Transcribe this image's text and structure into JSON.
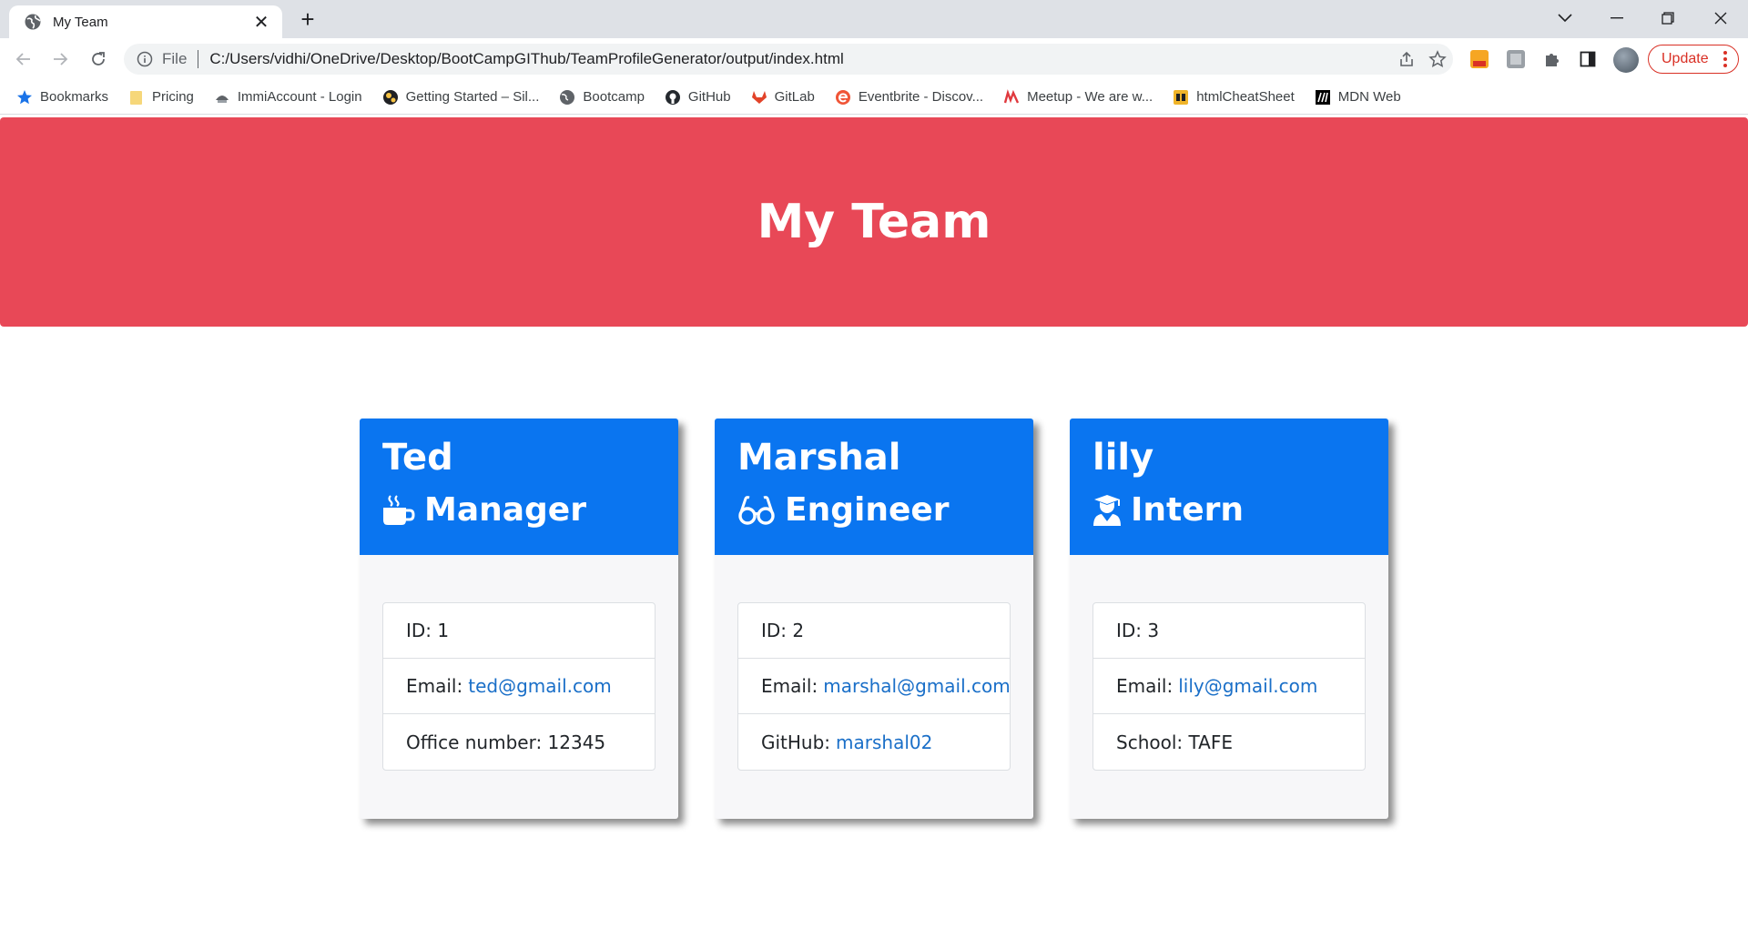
{
  "browser": {
    "tab_title": "My Team",
    "omnibox": {
      "scheme": "File",
      "url": "C:/Users/vidhi/OneDrive/Desktop/BootCampGIThub/TeamProfileGenerator/output/index.html"
    },
    "update_label": "Update",
    "bookmarks": [
      {
        "label": "Bookmarks",
        "icon": "star-icon",
        "color": "#1a73e8"
      },
      {
        "label": "Pricing",
        "icon": "folder-icon",
        "color": "#f6d365"
      },
      {
        "label": "ImmiAccount - Login",
        "icon": "crest-icon",
        "color": "#5f6368"
      },
      {
        "label": "Getting Started – Sil...",
        "icon": "gears-icon",
        "color": "#3c4043"
      },
      {
        "label": "Bootcamp",
        "icon": "globe-icon",
        "color": "#5f6368"
      },
      {
        "label": "GitHub",
        "icon": "github-icon",
        "color": "#24292e"
      },
      {
        "label": "GitLab",
        "icon": "gitlab-icon",
        "color": "#e24329"
      },
      {
        "label": "Eventbrite - Discov...",
        "icon": "eventbrite-icon",
        "color": "#f05537"
      },
      {
        "label": "Meetup - We are w...",
        "icon": "meetup-icon",
        "color": "#e0393e"
      },
      {
        "label": "htmlCheatSheet",
        "icon": "fs-icon",
        "color": "#f0b429"
      },
      {
        "label": "MDN Web",
        "icon": "mdn-icon",
        "color": "#000000"
      }
    ]
  },
  "page": {
    "title": "My Team",
    "colors": {
      "jumbotron": "#e84857",
      "card_header": "#0a75f0",
      "link": "#1a6fc8"
    },
    "members": [
      {
        "name": "Ted",
        "role": "Manager",
        "role_icon": "coffee-mug-icon",
        "id_text": "ID: 1",
        "email_label": "Email:",
        "email": "ted@gmail.com",
        "extra_label": "Office number: 12345",
        "extra_value": ""
      },
      {
        "name": "Marshal",
        "role": "Engineer",
        "role_icon": "glasses-icon",
        "id_text": "ID: 2",
        "email_label": "Email:",
        "email": "marshal@gmail.com",
        "extra_label": "GitHub:",
        "extra_value": "marshal02"
      },
      {
        "name": "lily",
        "role": "Intern",
        "role_icon": "graduate-icon",
        "id_text": "ID: 3",
        "email_label": "Email:",
        "email": "lily@gmail.com",
        "extra_label": "School: TAFE",
        "extra_value": ""
      }
    ]
  }
}
